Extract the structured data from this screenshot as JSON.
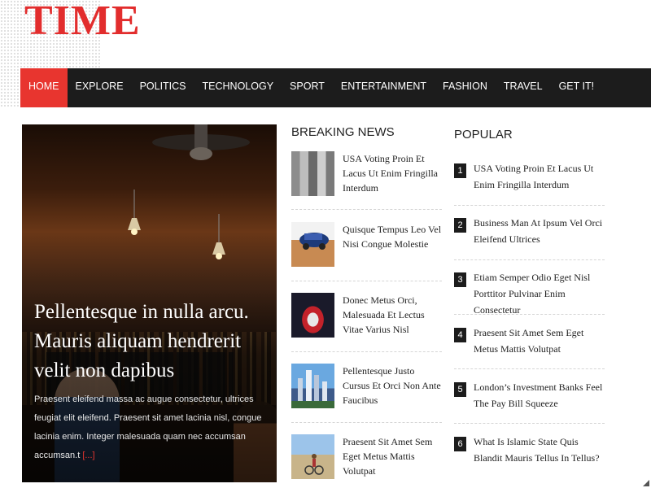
{
  "site": {
    "logo": "TIME"
  },
  "nav": {
    "items": [
      {
        "label": "HOME",
        "active": true
      },
      {
        "label": "EXPLORE",
        "active": false
      },
      {
        "label": "POLITICS",
        "active": false
      },
      {
        "label": "TECHNOLOGY",
        "active": false
      },
      {
        "label": "SPORT",
        "active": false
      },
      {
        "label": "ENTERTAINMENT",
        "active": false
      },
      {
        "label": "FASHION",
        "active": false
      },
      {
        "label": "TRAVEL",
        "active": false
      },
      {
        "label": "GET IT!",
        "active": false
      }
    ]
  },
  "feature": {
    "title": "Pellentesque in nulla arcu. Mauris aliquam hendrerit velit non dapibus",
    "excerpt": "Praesent eleifend massa ac augue consectetur, ultrices feugiat elit eleifend. Praesent sit amet lacinia nisl, congue lacinia enim. Integer malesuada quam nec accumsan accumsan.t",
    "more": "[...]"
  },
  "breaking": {
    "title": "BREAKING NEWS",
    "items": [
      {
        "text": "USA Voting Proin Et Lacus Ut Enim Fringilla Interdum"
      },
      {
        "text": "Quisque Tempus Leo Vel Nisi Congue Molestie"
      },
      {
        "text": "Donec Metus Orci, Malesuada Et Lectus Vitae Varius Nisl"
      },
      {
        "text": "Pellentesque Justo Cursus Et Orci Non Ante Faucibus"
      },
      {
        "text": "Praesent Sit Amet Sem Eget Metus Mattis Volutpat"
      }
    ]
  },
  "popular": {
    "title": "POPULAR",
    "items": [
      {
        "num": "1",
        "text": "USA Voting Proin Et Lacus Ut Enim Fringilla Interdum"
      },
      {
        "num": "2",
        "text": "Business Man At Ipsum Vel Orci Eleifend Ultrices"
      },
      {
        "num": "3",
        "text": "Etiam Semper Odio Eget Nisl Porttitor Pulvinar Enim Consectetur"
      },
      {
        "num": "4",
        "text": "Praesent Sit Amet Sem Eget Metus Mattis Volutpat"
      },
      {
        "num": "5",
        "text": "London’s Investment Banks Feel The Pay Bill Squeeze"
      },
      {
        "num": "6",
        "text": "What Is Islamic State Quis Blandit Mauris Tellus In Tellus?"
      }
    ]
  },
  "colors": {
    "accent": "#e8352f",
    "logo": "#e22d2d",
    "nav_bg": "#1c1c1c"
  }
}
